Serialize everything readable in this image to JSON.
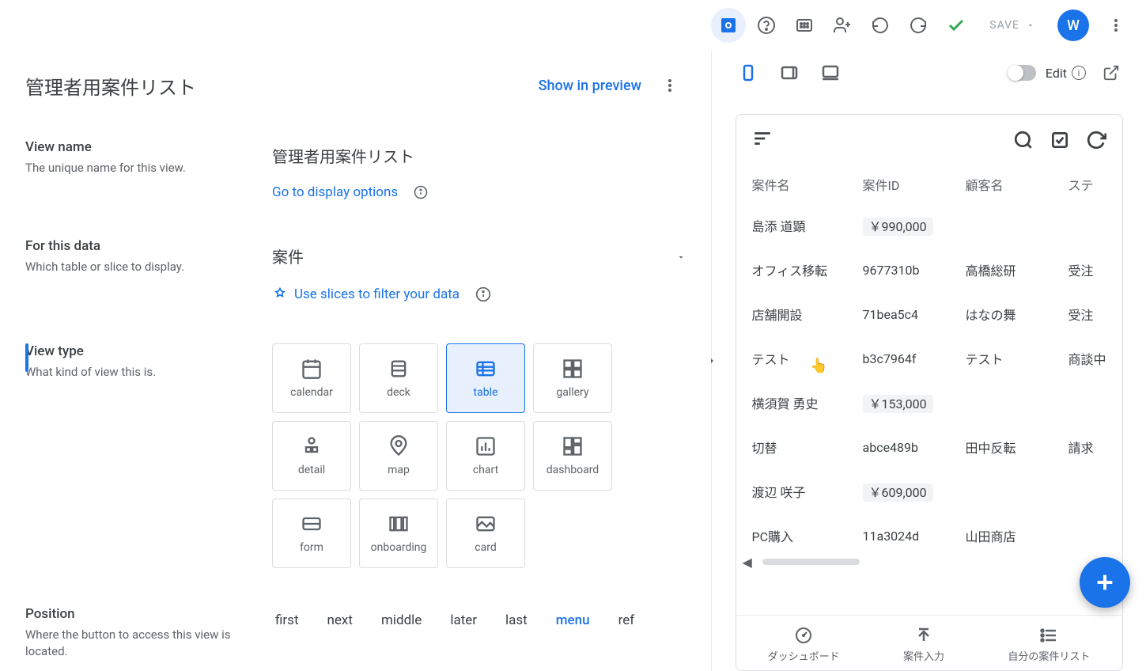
{
  "toolbar": {
    "save_label": "SAVE",
    "avatar_initial": "W"
  },
  "editor": {
    "title": "管理者用案件リスト",
    "show_preview": "Show in preview",
    "fields": {
      "view_name": {
        "label": "View name",
        "desc": "The unique name for this view.",
        "value": "管理者用案件リスト",
        "display_options_link": "Go to display options"
      },
      "for_data": {
        "label": "For this data",
        "desc": "Which table or slice to display.",
        "value": "案件",
        "slices_link": "Use slices to filter your data"
      },
      "view_type": {
        "label": "View type",
        "desc": "What kind of view this is.",
        "options": [
          "calendar",
          "deck",
          "table",
          "gallery",
          "detail",
          "map",
          "chart",
          "dashboard",
          "form",
          "onboarding",
          "card"
        ],
        "selected": "table"
      },
      "position": {
        "label": "Position",
        "desc": "Where the button to access this view is located.",
        "options": [
          "first",
          "next",
          "middle",
          "later",
          "last",
          "menu",
          "ref"
        ],
        "selected": "menu"
      }
    }
  },
  "preview": {
    "edit_label": "Edit",
    "table": {
      "columns": [
        "案件名",
        "案件ID",
        "顧客名",
        "ステ"
      ],
      "rows": [
        {
          "type": "group",
          "name": "島添 道顕",
          "price": "￥990,000"
        },
        {
          "name": "オフィス移転",
          "id": "9677310b",
          "customer": "高橋総研",
          "status": "受注"
        },
        {
          "name": "店舗開設",
          "id": "71bea5c4",
          "customer": "はなの舞",
          "status": "受注"
        },
        {
          "name": "テスト",
          "id": "b3c7964f",
          "customer": "テスト",
          "status": "商談中"
        },
        {
          "type": "group",
          "name": "横須賀 勇史",
          "price": "￥153,000"
        },
        {
          "name": "切替",
          "id": "abce489b",
          "customer": "田中反転",
          "status": "請求"
        },
        {
          "type": "group",
          "name": "渡辺 咲子",
          "price": "￥609,000"
        },
        {
          "name": "PC購入",
          "id": "11a3024d",
          "customer": "山田商店",
          "status": ""
        }
      ]
    },
    "bottom_nav": [
      "ダッシュボード",
      "案件入力",
      "自分の案件リスト"
    ]
  }
}
